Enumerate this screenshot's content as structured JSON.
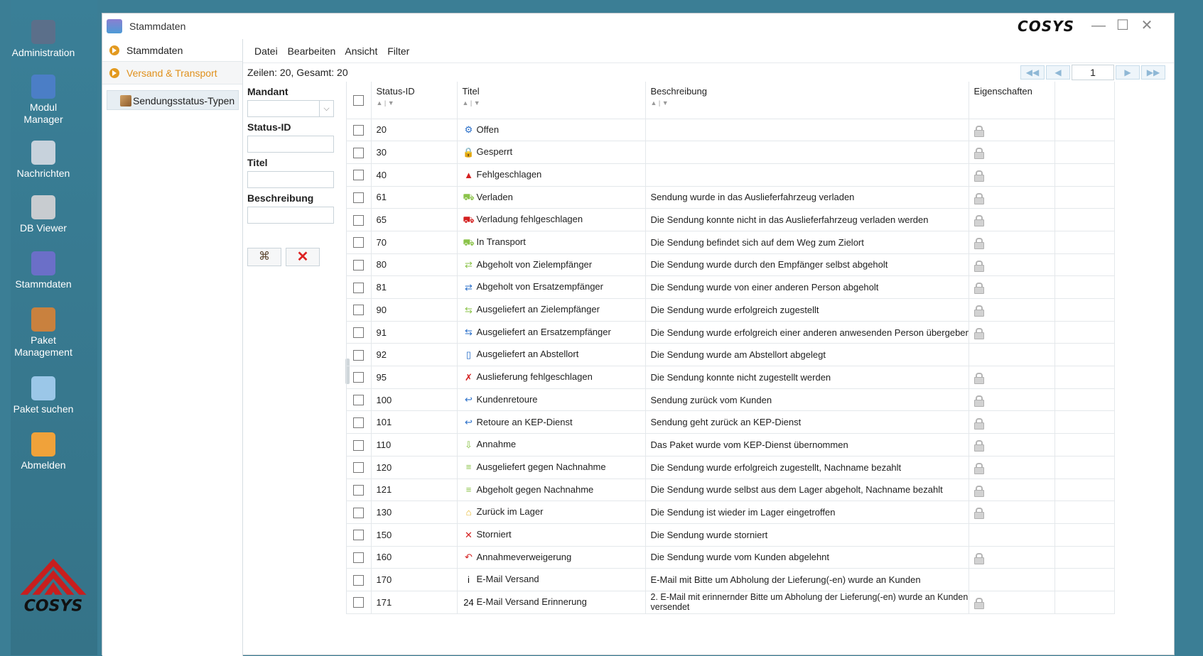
{
  "desktop": {
    "items": [
      {
        "label": "Administration",
        "color": "#5b6f8a"
      },
      {
        "label": "Modul\nManager",
        "color": "#4b7ec6"
      },
      {
        "label": "Nachrichten",
        "color": "#c7d2dc"
      },
      {
        "label": "DB Viewer",
        "color": "#c8ccd0"
      },
      {
        "label": "Stammdaten",
        "color": "#6b6fc8"
      },
      {
        "label": "Paket\nManagement",
        "color": "#c9813e"
      },
      {
        "label": "Paket suchen",
        "color": "#9bc7e8"
      },
      {
        "label": "Abmelden",
        "color": "#f0a23a"
      }
    ],
    "logo_text": "COSYS"
  },
  "window": {
    "title": "Stammdaten",
    "brand": "COSYS",
    "controls": {
      "minimize": "—",
      "maximize": "☐",
      "close": "✕"
    }
  },
  "modnav": {
    "items": [
      {
        "label": "Stammdaten",
        "state": "normal"
      },
      {
        "label": "Versand & Transport",
        "state": "active"
      }
    ],
    "tree_item": "Sendungsstatus-Typen"
  },
  "menu": {
    "items": [
      "Datei",
      "Bearbeiten",
      "Ansicht",
      "Filter"
    ]
  },
  "info": {
    "rows_text": "Zeilen: 20, Gesamt: 20"
  },
  "pager": {
    "first": "◀◀",
    "prev": "◀",
    "page": "1",
    "next": "▶",
    "last": "▶▶"
  },
  "filter": {
    "mandant_label": "Mandant",
    "status_id_label": "Status-ID",
    "titel_label": "Titel",
    "beschreibung_label": "Beschreibung"
  },
  "grid": {
    "columns": [
      "Status-ID",
      "Titel",
      "Beschreibung",
      "Eigenschaften"
    ],
    "sort_glyph": "▲ | ▼",
    "rows": [
      {
        "id": "20",
        "title": "Offen",
        "desc": "",
        "icon": "gear-icon",
        "glyph": "⚙",
        "color": "#2a6fc9",
        "lock": true
      },
      {
        "id": "30",
        "title": "Gesperrt",
        "desc": "",
        "icon": "padlock-icon",
        "glyph": "🔒",
        "color": "#f0b400",
        "lock": true
      },
      {
        "id": "40",
        "title": "Fehlgeschlagen",
        "desc": "",
        "icon": "warning-icon",
        "glyph": "▲",
        "color": "#d42020",
        "lock": true
      },
      {
        "id": "61",
        "title": "Verladen",
        "desc": "Sendung wurde in das Auslieferfahrzeug verladen",
        "icon": "truck-loading-icon",
        "glyph": "⛟",
        "color": "#8bc34a",
        "lock": true
      },
      {
        "id": "65",
        "title": "Verladung fehlgeschlagen",
        "desc": "Die Sendung konnte nicht in das Auslieferfahrzeug verladen werden",
        "icon": "truck-error-icon",
        "glyph": "⛟",
        "color": "#d42020",
        "lock": true
      },
      {
        "id": "70",
        "title": "In Transport",
        "desc": "Die Sendung befindet sich auf dem Weg zum Zielort",
        "icon": "truck-icon",
        "glyph": "⛟",
        "color": "#8bc34a",
        "lock": true
      },
      {
        "id": "80",
        "title": "Abgeholt von Zielempfänger",
        "desc": "Die Sendung wurde durch den Empfänger selbst abgeholt",
        "icon": "pickup-recipient-icon",
        "glyph": "⇄",
        "color": "#8bc34a",
        "lock": true
      },
      {
        "id": "81",
        "title": "Abgeholt von Ersatzempfänger",
        "desc": "Die Sendung wurde von einer anderen Person abgeholt",
        "icon": "pickup-substitute-icon",
        "glyph": "⇄",
        "color": "#2a6fc9",
        "lock": true
      },
      {
        "id": "90",
        "title": "Ausgeliefert an Zielempfänger",
        "desc": "Die Sendung wurde erfolgreich zugestellt",
        "icon": "deliver-recipient-icon",
        "glyph": "⇆",
        "color": "#8bc34a",
        "lock": true
      },
      {
        "id": "91",
        "title": "Ausgeliefert an Ersatzempfänger",
        "desc": "Die Sendung wurde erfolgreich einer anderen anwesenden Person übergeben",
        "icon": "deliver-substitute-icon",
        "glyph": "⇆",
        "color": "#2a6fc9",
        "lock": true
      },
      {
        "id": "92",
        "title": "Ausgeliefert an Abstellort",
        "desc": "Die Sendung wurde am Abstellort abgelegt",
        "icon": "drop-off-icon",
        "glyph": "▯",
        "color": "#2a6fc9",
        "lock": false
      },
      {
        "id": "95",
        "title": "Auslieferung fehlgeschlagen",
        "desc": "Die Sendung konnte nicht zugestellt werden",
        "icon": "delivery-failed-icon",
        "glyph": "✗",
        "color": "#d42020",
        "lock": true
      },
      {
        "id": "100",
        "title": "Kundenretoure",
        "desc": "Sendung zurück vom Kunden",
        "icon": "return-arrow-icon",
        "glyph": "↩",
        "color": "#2a6fc9",
        "lock": true
      },
      {
        "id": "101",
        "title": "Retoure an KEP-Dienst",
        "desc": "Sendung geht zurück an KEP-Dienst",
        "icon": "return-arrow-icon",
        "glyph": "↩",
        "color": "#2a6fc9",
        "lock": true
      },
      {
        "id": "110",
        "title": "Annahme",
        "desc": "Das Paket wurde vom KEP-Dienst übernommen",
        "icon": "acceptance-icon",
        "glyph": "⇩",
        "color": "#8bc34a",
        "lock": true
      },
      {
        "id": "120",
        "title": "Ausgeliefert gegen Nachnahme",
        "desc": "Die Sendung wurde erfolgreich zugestellt, Nachname bezahlt",
        "icon": "cash-on-delivery-icon",
        "glyph": "≡",
        "color": "#8bc34a",
        "lock": true
      },
      {
        "id": "121",
        "title": "Abgeholt gegen Nachnahme",
        "desc": "Die Sendung wurde selbst aus dem Lager abgeholt, Nachname bezahlt",
        "icon": "cash-on-delivery-icon",
        "glyph": "≡",
        "color": "#8bc34a",
        "lock": true
      },
      {
        "id": "130",
        "title": "Zurück im Lager",
        "desc": "Die Sendung ist wieder im Lager eingetroffen",
        "icon": "warehouse-icon",
        "glyph": "⌂",
        "color": "#e6b422",
        "lock": true
      },
      {
        "id": "150",
        "title": "Storniert",
        "desc": "Die Sendung wurde storniert",
        "icon": "cancel-icon",
        "glyph": "✕",
        "color": "#d42020",
        "lock": false
      },
      {
        "id": "160",
        "title": "Annahmeverweigerung",
        "desc": "Die Sendung wurde vom Kunden abgelehnt",
        "icon": "refusal-arrow-icon",
        "glyph": "↶",
        "color": "#d42020",
        "lock": true
      },
      {
        "id": "170",
        "title": "E-Mail Versand",
        "desc": "E-Mail mit Bitte um Abholung der Lieferung(-en) wurde an Kunden",
        "icon": "info-icon",
        "glyph": "i",
        "color": "#111111",
        "lock": false
      },
      {
        "id": "171",
        "title": "E-Mail Versand Erinnerung",
        "desc": "2. E-Mail mit erinnernder Bitte um Abholung der Lieferung(-en) wurde an Kunden versendet",
        "icon": "reminder-24h-icon",
        "glyph": "24",
        "color": "#111111",
        "lock": true
      }
    ]
  }
}
